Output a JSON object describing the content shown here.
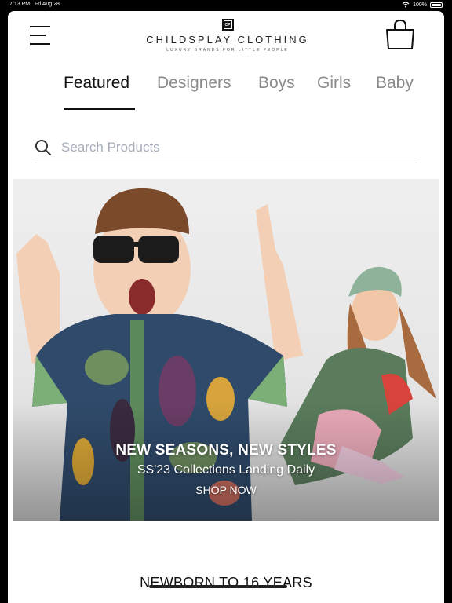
{
  "status_bar": {
    "time": "7:13 PM",
    "date": "Fri Aug 28",
    "battery": "100%"
  },
  "header": {
    "logo_mark": "CP",
    "brand_name": "CHILDSPLAY CLOTHING",
    "tagline": "LUXURY BRANDS FOR LITTLE PEOPLE",
    "menu_icon": "hamburger-menu-icon",
    "bag_icon": "shopping-bag-icon"
  },
  "tabs": [
    {
      "label": "Featured",
      "active": true
    },
    {
      "label": "Designers",
      "active": false
    },
    {
      "label": "Boys",
      "active": false
    },
    {
      "label": "Girls",
      "active": false
    },
    {
      "label": "Baby",
      "active": false
    }
  ],
  "search": {
    "placeholder": "Search Products",
    "value": "",
    "icon": "search-icon"
  },
  "hero": {
    "title": "NEW SEASONS, NEW STYLES",
    "subtitle": "SS'23 Collections Landing Daily",
    "cta": "SHOP NOW"
  },
  "age_range": "NEWBORN TO 16 YEARS",
  "colors": {
    "background": "#ffffff",
    "text": "#111111",
    "inactive_tab": "#8a8a8a",
    "placeholder": "#a5adba"
  }
}
